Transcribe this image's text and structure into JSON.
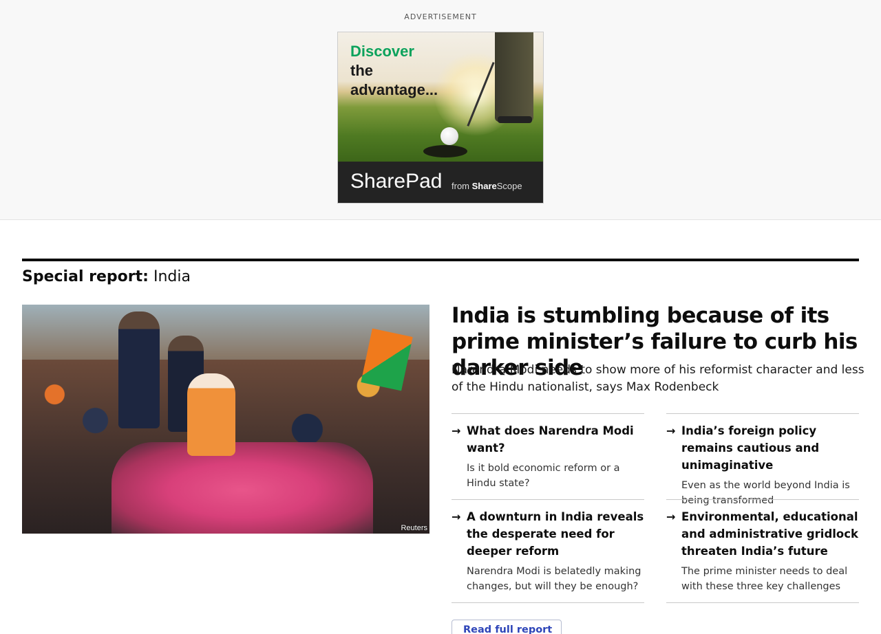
{
  "ad": {
    "label": "ADVERTISEMENT",
    "headline_line1": "Discover",
    "headline_line2": "the",
    "headline_line3": "advantage...",
    "brand_share": "Share",
    "brand_pad": "Pad",
    "from_text": "from",
    "from_brand_share": "Share",
    "from_brand_scope": "Scope",
    "accent_color": "#0ca25c"
  },
  "section": {
    "label_bold": "Special report:",
    "label_topic": "India"
  },
  "hero": {
    "image_credit": "Reuters",
    "headline": "India is stumbling because of its prime minister’s failure to curb his darker side",
    "dek": "Narendra Modi needs to show more of his reformist character and less of the Hindu nationalist, says Max Rodenbeck"
  },
  "related": [
    {
      "title": "What does Narendra Modi want?",
      "desc": "Is it bold economic reform or a Hindu state?"
    },
    {
      "title": "India’s foreign policy remains cautious and unimaginative",
      "desc": "Even as the world beyond India is being transformed"
    },
    {
      "title": "A downturn in India reveals the desperate need for deeper reform",
      "desc": "Narendra Modi is belatedly making changes, but will they be enough?"
    },
    {
      "title": "Environmental, educational and administrative gridlock threaten India’s future",
      "desc": "The prime minister needs to deal with these three key challenges"
    }
  ],
  "arrow_glyph": "→",
  "read_full_report": "Read full report →",
  "link_color": "#2e45b8"
}
